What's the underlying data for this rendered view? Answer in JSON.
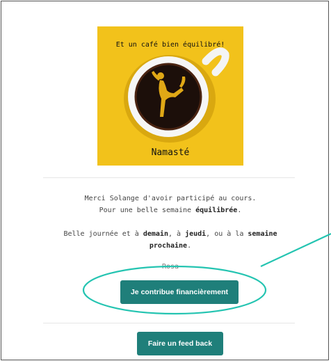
{
  "hero": {
    "caption": "Et un café bien équilibré!",
    "name": "Namasté"
  },
  "message": {
    "line1": "Merci Solange d'avoir participé au cours.",
    "line2_pre": "Pour une belle semaine ",
    "line2_bold": "équilibrée",
    "line2_post": ".",
    "line3_a": "Belle journée et à ",
    "line3_b": "demain",
    "line3_c": ", à ",
    "line3_d": "jeudi",
    "line3_e": ", ou à la ",
    "line3_f": "semaine",
    "line4": "prochaine",
    "line4_post": ".",
    "signature": "Rosa"
  },
  "buttons": {
    "contribute": "Je contribue financièrement",
    "feedback": "Faire un feed back"
  },
  "colors": {
    "accent": "#1f7f7a",
    "highlight": "#24c4b1",
    "hero_bg": "#f2c21b"
  }
}
